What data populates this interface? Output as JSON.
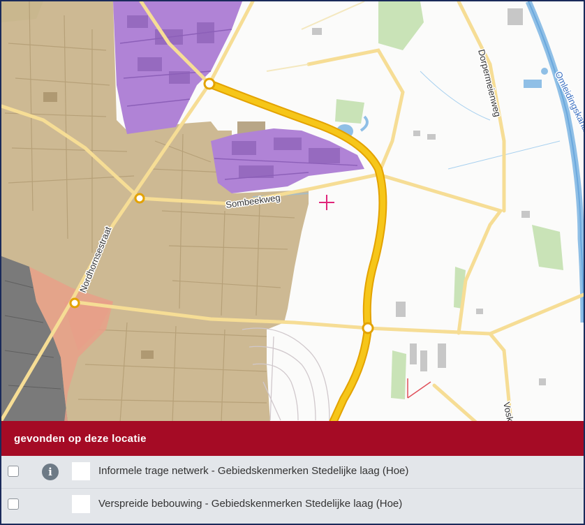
{
  "map": {
    "labels": {
      "sombeekweg": "Sombeekweg",
      "nordhornsestraat": "Nordhornsestraat",
      "dorpermeienweg": "Dorpermeienweg",
      "omleidingskanaal": "Omleidingskanaal",
      "vosk": "Vosk"
    },
    "colors": {
      "residential": "#c9b38a",
      "industrial": "#b083d6",
      "center": "#7a7a7a",
      "mixed": "#e8a088",
      "road_major": "#f6c619",
      "road_minor": "#f6dd95",
      "water": "#8fbfe6",
      "green": "#c9e3b7",
      "marker": "#e0257a"
    }
  },
  "panel": {
    "title": "gevonden op deze locatie",
    "rows": [
      {
        "label": "Informele trage netwerk - Gebiedskenmerken Stedelijke laag (Hoe)",
        "has_info": true,
        "info_icon": "info-icon"
      },
      {
        "label": "Verspreide bebouwing - Gebiedskenmerken Stedelijke laag (Hoe)",
        "has_info": false
      }
    ],
    "colors": {
      "header": "#a50b25",
      "background": "#e3e6ea"
    }
  }
}
